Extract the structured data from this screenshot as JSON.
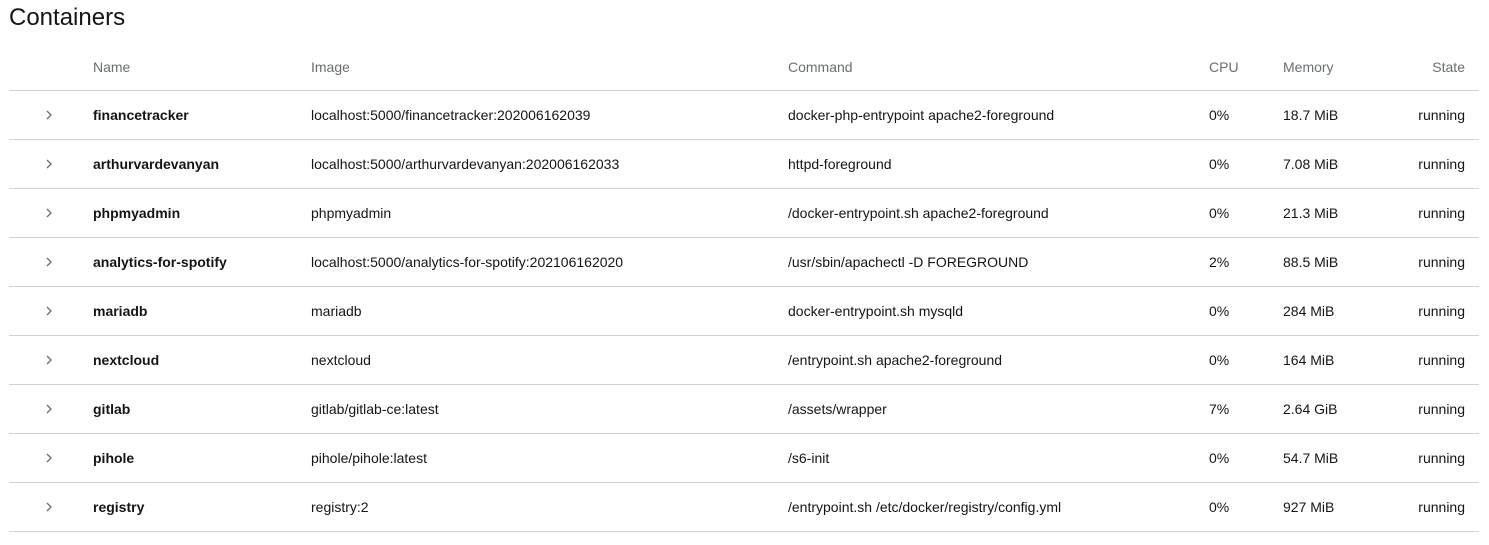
{
  "page": {
    "title": "Containers"
  },
  "table": {
    "headers": {
      "name": "Name",
      "image": "Image",
      "command": "Command",
      "cpu": "CPU",
      "memory": "Memory",
      "state": "State"
    },
    "rows": [
      {
        "name": "financetracker",
        "image": "localhost:5000/financetracker:202006162039",
        "command": "docker-php-entrypoint apache2-foreground",
        "cpu": "0%",
        "memory": "18.7 MiB",
        "state": "running"
      },
      {
        "name": "arthurvardevanyan",
        "image": "localhost:5000/arthurvardevanyan:202006162033",
        "command": "httpd-foreground",
        "cpu": "0%",
        "memory": "7.08 MiB",
        "state": "running"
      },
      {
        "name": "phpmyadmin",
        "image": "phpmyadmin",
        "command": "/docker-entrypoint.sh apache2-foreground",
        "cpu": "0%",
        "memory": "21.3 MiB",
        "state": "running"
      },
      {
        "name": "analytics-for-spotify",
        "image": "localhost:5000/analytics-for-spotify:202106162020",
        "command": "/usr/sbin/apachectl -D FOREGROUND",
        "cpu": "2%",
        "memory": "88.5 MiB",
        "state": "running"
      },
      {
        "name": "mariadb",
        "image": "mariadb",
        "command": "docker-entrypoint.sh mysqld",
        "cpu": "0%",
        "memory": "284 MiB",
        "state": "running"
      },
      {
        "name": "nextcloud",
        "image": "nextcloud",
        "command": "/entrypoint.sh apache2-foreground",
        "cpu": "0%",
        "memory": "164 MiB",
        "state": "running"
      },
      {
        "name": "gitlab",
        "image": "gitlab/gitlab-ce:latest",
        "command": "/assets/wrapper",
        "cpu": "7%",
        "memory": "2.64 GiB",
        "state": "running"
      },
      {
        "name": "pihole",
        "image": "pihole/pihole:latest",
        "command": "/s6-init",
        "cpu": "0%",
        "memory": "54.7 MiB",
        "state": "running"
      },
      {
        "name": "registry",
        "image": "registry:2",
        "command": "/entrypoint.sh /etc/docker/registry/config.yml",
        "cpu": "0%",
        "memory": "927 MiB",
        "state": "running"
      }
    ]
  },
  "icons": {
    "row_toggle": "chevron-right-icon"
  },
  "colors": {
    "text": "#151515",
    "header_text": "#6a6e73",
    "divider": "#d2d2d2"
  }
}
